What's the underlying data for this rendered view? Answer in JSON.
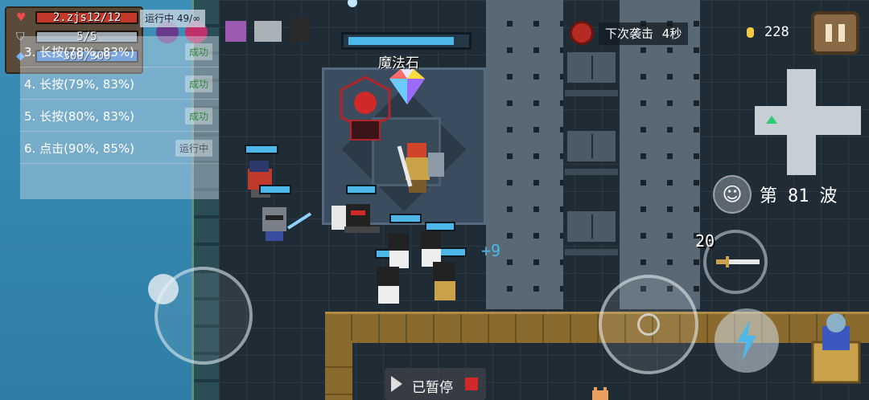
{
  "hud": {
    "hp": {
      "value": 12,
      "max": 12,
      "text": "2.zjs12/12"
    },
    "armor": {
      "value": 5,
      "max": 5,
      "text": "5/5"
    },
    "energy": {
      "value": 300,
      "max": 300,
      "text": "300/300"
    }
  },
  "script_overlay": {
    "top_status": "运行中 49/∞",
    "rows": [
      {
        "text": "3. 长按(78%, 83%)",
        "status": "成功"
      },
      {
        "text": "4. 长按(79%, 83%)",
        "status": "成功"
      },
      {
        "text": "5. 长按(80%, 83%)",
        "status": "成功"
      },
      {
        "text": "6. 点击(90%, 85%)",
        "status": "运行中"
      }
    ]
  },
  "boss": {
    "name": "魔法石",
    "hp_fraction": 0.95
  },
  "wave_timer": {
    "label": "下次袭击",
    "value": "4秒"
  },
  "coins": "228",
  "wave": {
    "prefix": "第",
    "number": "81",
    "suffix": "波"
  },
  "weapon": {
    "ammo": "20"
  },
  "heal_popup": "+9",
  "paused_label": "已暂停",
  "colors": {
    "accent": "#4db8e8",
    "hp": "#c0392b",
    "armor": "#9aa4ac",
    "energy": "#3f7fd6",
    "gold": "#f5c842"
  },
  "icons": {
    "hp": "heart-icon",
    "armor": "shield-icon",
    "energy": "diamond-icon",
    "timer": "alarm-clock-icon",
    "coin": "coin-icon",
    "pause": "pause-icon",
    "wave": "smiley-icon",
    "attack": "crosshair-icon",
    "skill": "lightning-icon",
    "weapon": "sword-icon"
  }
}
